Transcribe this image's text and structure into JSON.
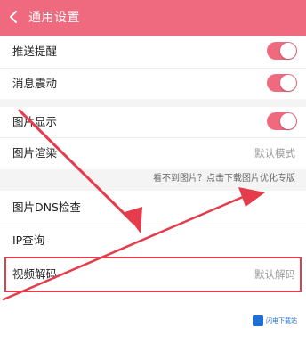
{
  "header": {
    "title": "通用设置"
  },
  "settings": [
    {
      "label": "推送提醒",
      "toggle": true
    },
    {
      "label": "消息震动",
      "toggle": true
    },
    {
      "label": "图片显示",
      "toggle": true
    },
    {
      "label": "图片渲染",
      "value": "默认模式"
    }
  ],
  "hint": "看不到图片？点击下载图片优化专版",
  "settings2": [
    {
      "label": "图片DNS检查"
    },
    {
      "label": "IP查询"
    },
    {
      "label": "视频解码",
      "value": "默认解码"
    }
  ],
  "watermark": {
    "text": "闪电下载站"
  },
  "colors": {
    "accent": "#f06a7f",
    "annotation": "#e53c4c"
  }
}
